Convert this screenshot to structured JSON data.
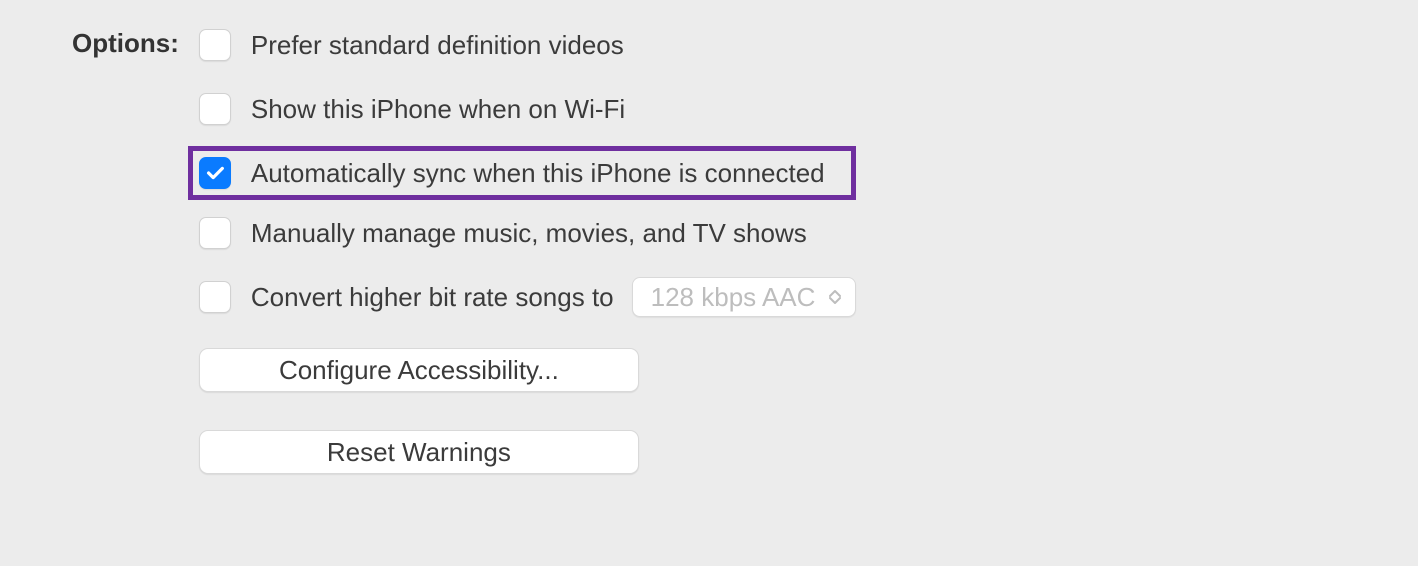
{
  "section_label": "Options:",
  "options": {
    "prefer_sd": {
      "label": "Prefer standard definition videos",
      "checked": false
    },
    "show_wifi": {
      "label": "Show this iPhone when on Wi-Fi",
      "checked": false
    },
    "auto_sync": {
      "label": "Automatically sync when this iPhone is connected",
      "checked": true
    },
    "manual_manage": {
      "label": "Manually manage music, movies, and TV shows",
      "checked": false
    },
    "convert_bitrate": {
      "label": "Convert higher bit rate songs to",
      "checked": false,
      "select_value": "128 kbps AAC"
    }
  },
  "buttons": {
    "configure_accessibility": "Configure Accessibility...",
    "reset_warnings": "Reset Warnings"
  }
}
